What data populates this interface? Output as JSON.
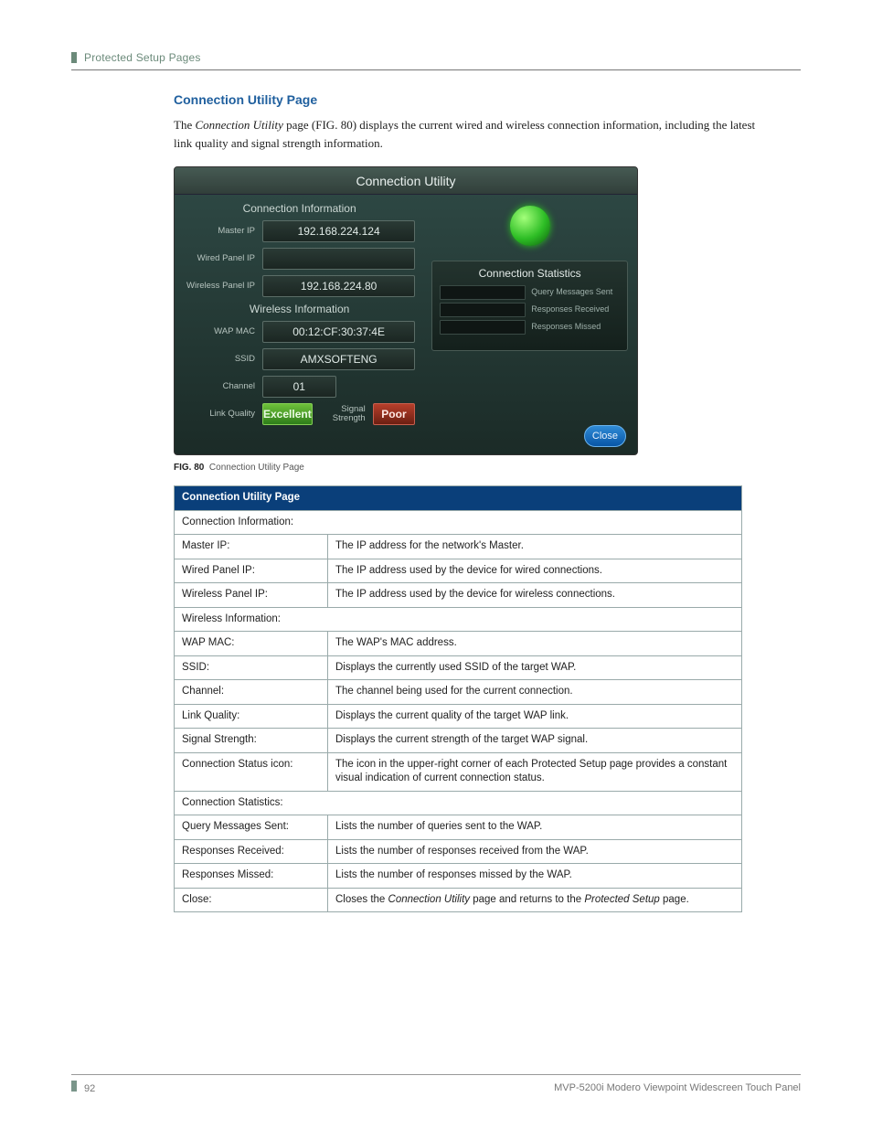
{
  "header": {
    "breadcrumb": "Protected Setup Pages"
  },
  "section": {
    "heading": "Connection Utility Page",
    "intro_pre": "The ",
    "intro_em": "Connection Utility",
    "intro_post": " page (FIG. 80) displays the current wired and wireless connection information, including the latest link quality and signal strength information."
  },
  "screenshot": {
    "title": "Connection Utility",
    "conn_info_hdr": "Connection Information",
    "wireless_info_hdr": "Wireless Information",
    "master_ip_label": "Master IP",
    "master_ip_value": "192.168.224.124",
    "wired_ip_label": "Wired Panel IP",
    "wired_ip_value": "",
    "wireless_ip_label": "Wireless Panel IP",
    "wireless_ip_value": "192.168.224.80",
    "wap_mac_label": "WAP MAC",
    "wap_mac_value": "00:12:CF:30:37:4E",
    "ssid_label": "SSID",
    "ssid_value": "AMXSOFTENG",
    "channel_label": "Channel",
    "channel_value": "01",
    "link_quality_label": "Link Quality",
    "link_quality_value": "Excellent",
    "signal_strength_label": "Signal Strength",
    "signal_strength_value": "Poor",
    "stats_hdr": "Connection Statistics",
    "stat1": "Query Messages Sent",
    "stat2": "Responses Received",
    "stat3": "Responses Missed",
    "close": "Close"
  },
  "figcap": {
    "bold": "FIG. 80",
    "text": "Connection Utility Page"
  },
  "table": {
    "title": "Connection Utility Page",
    "rows": [
      {
        "k": "Connection Information:",
        "v": "",
        "span": true
      },
      {
        "k": "Master IP:",
        "v": "The IP address for the network's Master.",
        "indent": true
      },
      {
        "k": "Wired Panel IP:",
        "v": "The IP address used by the device for wired connections.",
        "indent": true
      },
      {
        "k": "Wireless Panel IP:",
        "v": "The IP address used by the device for wireless connections.",
        "indent": true
      },
      {
        "k": "Wireless Information:",
        "v": "",
        "span": true
      },
      {
        "k": "WAP MAC:",
        "v": "The WAP's MAC address.",
        "indent": true
      },
      {
        "k": "SSID:",
        "v": "Displays the currently used SSID of the target WAP.",
        "indent": true
      },
      {
        "k": "Channel:",
        "v": "The channel being used for the current connection.",
        "indent": true
      },
      {
        "k": "Link Quality:",
        "v": "Displays the current quality of the target WAP link.",
        "indent": true
      },
      {
        "k": "Signal Strength:",
        "v": "Displays the current strength of the target WAP signal.",
        "indent": true
      },
      {
        "k": "Connection Status icon:",
        "v": "The icon in the upper-right corner of each Protected Setup page provides a constant visual indication of current connection status."
      },
      {
        "k": "Connection Statistics:",
        "v": "",
        "span": true
      },
      {
        "k": "Query Messages Sent:",
        "v": "Lists the number of queries sent to the WAP.",
        "indent": true
      },
      {
        "k": "Responses Received:",
        "v": "Lists the number of responses received from the WAP.",
        "indent": true
      },
      {
        "k": "Responses Missed:",
        "v": "Lists the number of responses missed by the WAP.",
        "indent": true
      },
      {
        "k": "Close:",
        "v_html": "Closes the <em>Connection Utility</em> page and returns to the <em>Protected Setup</em> page."
      }
    ]
  },
  "footer": {
    "page": "92",
    "doc": "MVP-5200i Modero Viewpoint Widescreen Touch Panel"
  }
}
